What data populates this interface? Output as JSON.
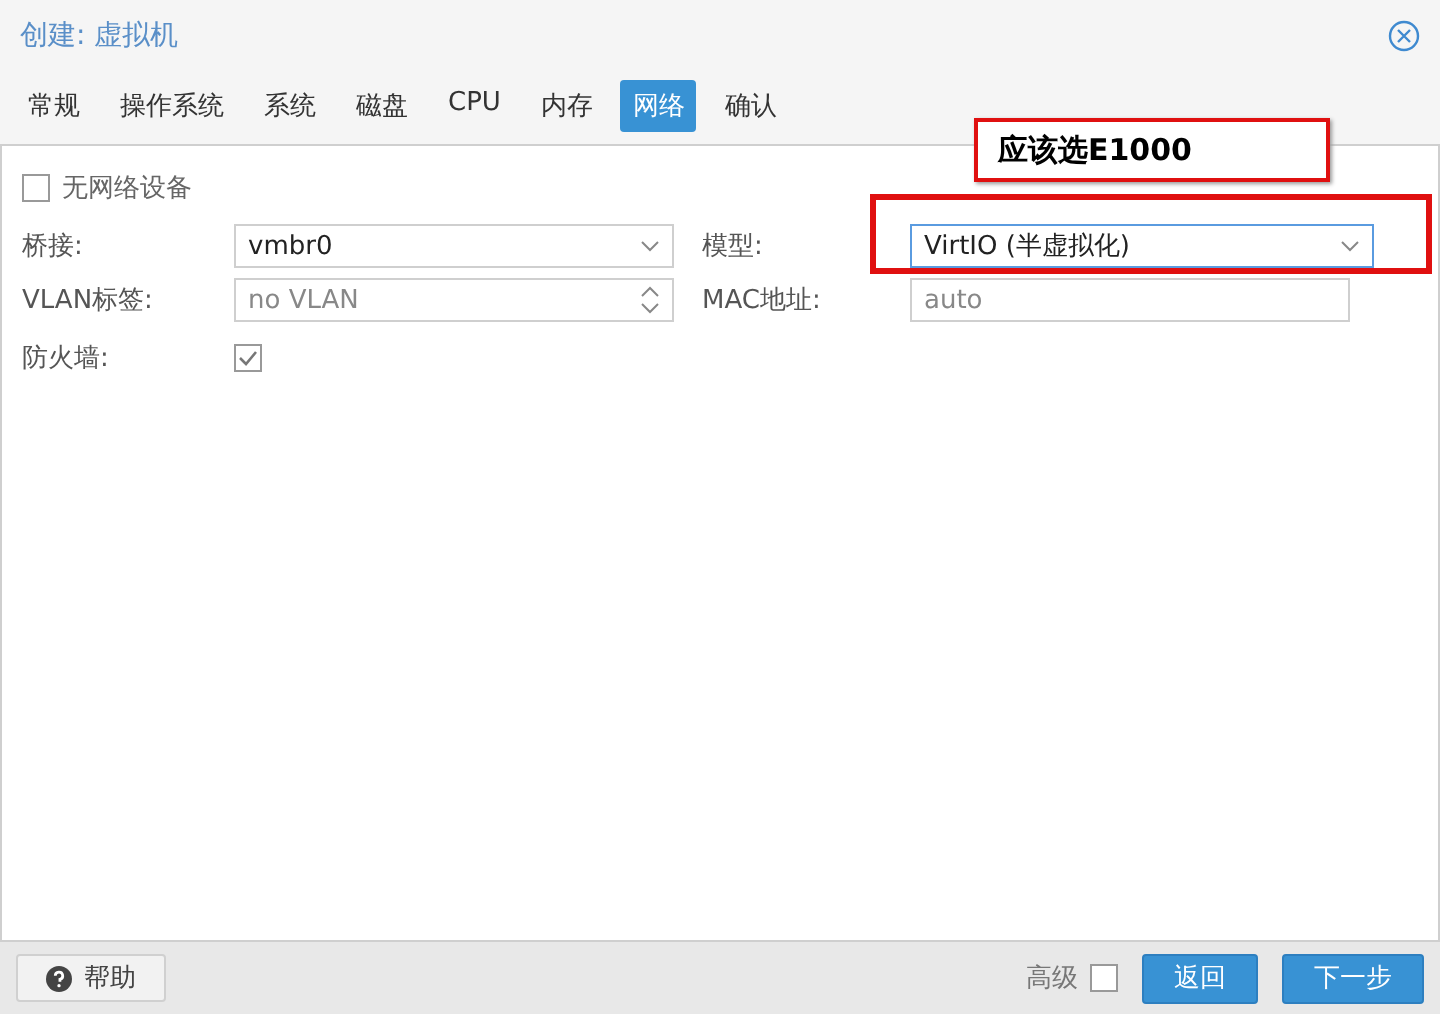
{
  "window": {
    "title": "创建: 虚拟机"
  },
  "tabs": [
    {
      "label": "常规",
      "selected": false
    },
    {
      "label": "操作系统",
      "selected": false
    },
    {
      "label": "系统",
      "selected": false
    },
    {
      "label": "磁盘",
      "selected": false
    },
    {
      "label": "CPU",
      "selected": false
    },
    {
      "label": "内存",
      "selected": false
    },
    {
      "label": "网络",
      "selected": true
    },
    {
      "label": "确认",
      "selected": false
    }
  ],
  "no_network": {
    "label": "无网络设备",
    "checked": false
  },
  "fields": [
    {
      "label": "桥接:",
      "kind": "combo",
      "value": "vmbr0"
    },
    {
      "label": "模型:",
      "kind": "combo",
      "value": "VirtIO (半虚拟化)"
    },
    {
      "label": "VLAN标签:",
      "kind": "spinner",
      "placeholder": "no VLAN"
    },
    {
      "label": "MAC地址:",
      "kind": "text",
      "placeholder": "auto"
    }
  ],
  "firewall": {
    "label": "防火墙:",
    "checked": true
  },
  "annotation": {
    "text": "应该选E1000"
  },
  "footer": {
    "help": "帮助",
    "advanced": {
      "label": "高级",
      "checked": false
    },
    "buttons": [
      "返回",
      "下一步"
    ]
  }
}
